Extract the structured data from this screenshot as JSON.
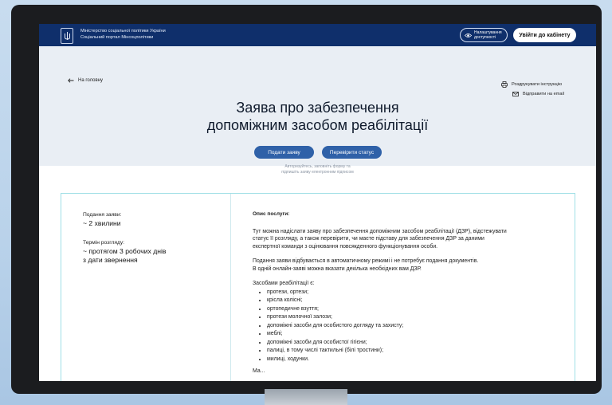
{
  "header": {
    "ministry_line1": "Міністерство соціальної політики України",
    "ministry_line2": "Соціальний портал Мінсоцполітики",
    "accessibility_line1": "Налаштування",
    "accessibility_line2": "доступності",
    "login_label": "Увійти до кабінету"
  },
  "nav": {
    "back_label": "На головну",
    "print_label": "Роздрукувати інструкцію",
    "email_label": "Відправити на email"
  },
  "hero": {
    "title_line1": "Заява про забезпечення",
    "title_line2": "допоміжним засобом реабілітації",
    "submit_label": "Подати заяву",
    "check_label": "Перевірити статус",
    "hint_line1": "Авторизуйтесь, заповніть форму та",
    "hint_line2": "підпишіть заяву електронним підписом"
  },
  "summary": {
    "submission_label": "Подання заяви:",
    "submission_value": "~ 2 хвилини",
    "term_label": "Термін розгляду:",
    "term_value_line1": "~ протягом 3 робочих днів",
    "term_value_line2": "з дати звернення"
  },
  "description": {
    "title": "Опис послуги:",
    "para1_line1": "Тут можна надіслати заяву про забезпечення допоміжним засобом реабілітації (ДЗР), відстежувати",
    "para1_line2": "статус її розгляду, а також перевірити, чи маєте підставу для забезпечення ДЗР за даними",
    "para1_line3": "експертної команди з оцінювання повсякденного функціонування особи.",
    "para2_line1": "Подання заяви відбувається в автоматичному режимі і не потребує подання документів.",
    "para2_line2": "В одній онлайн-заяві можна вказати декілька необхідних вам ДЗР.",
    "list_title": "Засобами реабілітації є:",
    "aids": [
      "протези, ортези;",
      "крісла колісні;",
      "ортопедичне взуття;",
      "протези молочної залози;",
      "допоміжні засоби для особистого догляду та захисту;",
      "меблі;",
      "допоміжні засоби для особистої гігієни;",
      "палиці, в тому числі тактильні (білі тростини);",
      "милиці, ходунки."
    ],
    "cut_text": "Ма..."
  },
  "icons": {
    "logo": "trident-icon",
    "back": "arrow-left-icon",
    "print": "printer-icon",
    "email": "mail-icon",
    "accessibility": "eye-icon"
  },
  "colors": {
    "header_bg": "#0f2f6b",
    "hero_bg": "#e9eef4",
    "accent": "#2f61a8",
    "card_border": "#9fdfe6"
  }
}
